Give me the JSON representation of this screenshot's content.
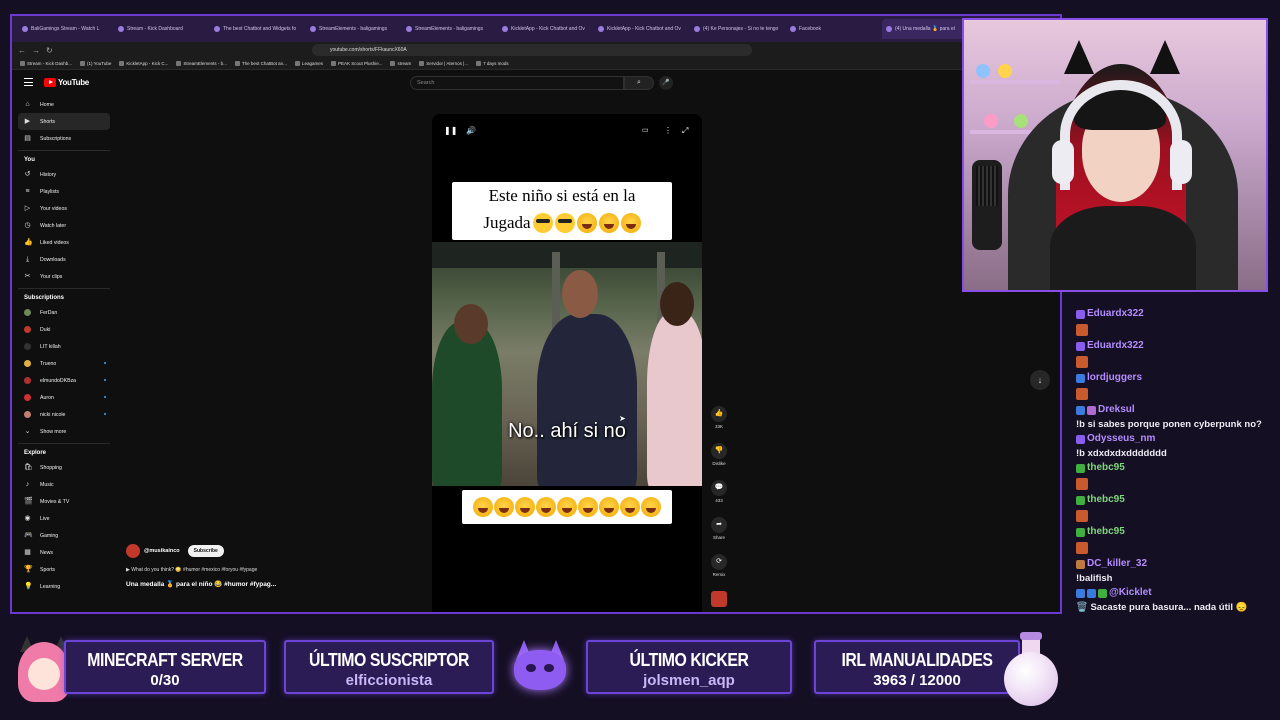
{
  "browser": {
    "tabs": [
      {
        "label": "BaliGamings Stream - Watch L",
        "active": false
      },
      {
        "label": "Stream - Kick Dashboard",
        "active": false
      },
      {
        "label": "The best Chatbot and Widgets fo",
        "active": false
      },
      {
        "label": "StreamElements - baligamings",
        "active": false
      },
      {
        "label": "StreamElements - baligamings",
        "active": false
      },
      {
        "label": "KickletApp - Kick Chatbot and Ov",
        "active": false
      },
      {
        "label": "KickletApp - Kick Chatbot and Ov",
        "active": false
      },
      {
        "label": "(4) Ke Personajes - Si no te tengo",
        "active": false
      },
      {
        "label": "Facebook",
        "active": false
      },
      {
        "label": "(4) Una medalla 🏅 para el",
        "active": true
      }
    ],
    "url": "youtube.com/shorts/FFkauncX60A",
    "bookmarks": [
      "Stream - Kick Dashb...",
      "(1) YouTube",
      "KickletApp - Kick C...",
      "StreamElements - b...",
      "The best ChatBot an...",
      "Leagames",
      "PEAK Scout Plushie...",
      "stream",
      "Servidor | Aternos |...",
      "7 days mods"
    ]
  },
  "youtube": {
    "logo": "YouTube",
    "search_placeholder": "Search",
    "nav": [
      {
        "label": "Home",
        "icon": "home-icon",
        "glyph": "⌂",
        "active": false
      },
      {
        "label": "Shorts",
        "icon": "shorts-icon",
        "glyph": "▶",
        "active": true
      },
      {
        "label": "Subscriptions",
        "icon": "subscriptions-icon",
        "glyph": "▤",
        "active": false
      }
    ],
    "you_heading": "You",
    "you_items": [
      {
        "label": "History",
        "icon": "history-icon",
        "glyph": "↺"
      },
      {
        "label": "Playlists",
        "icon": "playlists-icon",
        "glyph": "≡"
      },
      {
        "label": "Your videos",
        "icon": "your-videos-icon",
        "glyph": "▷"
      },
      {
        "label": "Watch later",
        "icon": "watch-later-icon",
        "glyph": "◷"
      },
      {
        "label": "Liked videos",
        "icon": "liked-videos-icon",
        "glyph": "👍"
      },
      {
        "label": "Downloads",
        "icon": "downloads-icon",
        "glyph": "⤓"
      },
      {
        "label": "Your clips",
        "icon": "clips-icon",
        "glyph": "✂"
      }
    ],
    "subscriptions_heading": "Subscriptions",
    "subscriptions": [
      {
        "label": "FerDan",
        "color": "#6a8a5a",
        "dot": false
      },
      {
        "label": "Duki",
        "color": "#c0392b",
        "dot": false
      },
      {
        "label": "LIT killah",
        "color": "#333333",
        "dot": false
      },
      {
        "label": "Trueno",
        "color": "#e0b040",
        "dot": true
      },
      {
        "label": "elmundoDKBza",
        "color": "#b03030",
        "dot": true
      },
      {
        "label": "Auron",
        "color": "#d03030",
        "dot": true
      },
      {
        "label": "nicki nicole",
        "color": "#c08070",
        "dot": true
      }
    ],
    "show_more": "Show more",
    "explore_heading": "Explore",
    "explore": [
      {
        "label": "Shopping",
        "icon": "shopping-icon",
        "glyph": "🛍"
      },
      {
        "label": "Music",
        "icon": "music-icon",
        "glyph": "♪"
      },
      {
        "label": "Movies & TV",
        "icon": "movies-icon",
        "glyph": "🎬"
      },
      {
        "label": "Live",
        "icon": "live-icon",
        "glyph": "◉"
      },
      {
        "label": "Gaming",
        "icon": "gaming-icon",
        "glyph": "🎮"
      },
      {
        "label": "News",
        "icon": "news-icon",
        "glyph": "▦"
      },
      {
        "label": "Sports",
        "icon": "sports-icon",
        "glyph": "🏆"
      },
      {
        "label": "Learning",
        "icon": "learning-icon",
        "glyph": "💡"
      }
    ],
    "short": {
      "caption_line1": "Este niño si está en la",
      "caption_line2": "Jugada",
      "scene_caption": "No.. ahí si no",
      "likes": "33K",
      "dislike": "Dislike",
      "comments": "433",
      "share": "Share",
      "remix": "Remix"
    },
    "channel": "@musikainco",
    "subscribe": "Subscribe",
    "desc_line": "▶ What do you think? 😳 #humor #mexico #foryou #fypage",
    "title": "Una medalla 🏅 para el niño 😂 #humor #fypag..."
  },
  "chat": [
    {
      "user": "Eduardx322",
      "color": "#b48cff",
      "badges": [
        "#8a5cf0"
      ],
      "text": "",
      "emote": true
    },
    {
      "user": "Eduardx322",
      "color": "#b48cff",
      "badges": [
        "#8a5cf0"
      ],
      "text": "",
      "emote": true
    },
    {
      "user": "lordjuggers",
      "color": "#b48cff",
      "badges": [
        "#3b7be0"
      ],
      "text": "",
      "emote": true
    },
    {
      "user": "Dreksul",
      "color": "#b48cff",
      "badges": [
        "#3b7be0",
        "#b06ad0"
      ],
      "text": "!b si sabes porque ponen cyberpunk no?",
      "emote": false
    },
    {
      "user": "Odysseus_nm",
      "color": "#b48cff",
      "badges": [
        "#8a5cf0"
      ],
      "text": "!b xdxdxdxddddddd",
      "emote": false
    },
    {
      "user": "thebc95",
      "color": "#7fd67a",
      "badges": [
        "#3fb03f"
      ],
      "text": "",
      "emote": true
    },
    {
      "user": "thebc95",
      "color": "#7fd67a",
      "badges": [
        "#3fb03f"
      ],
      "text": "",
      "emote": true
    },
    {
      "user": "thebc95",
      "color": "#7fd67a",
      "badges": [
        "#3fb03f"
      ],
      "text": "",
      "emote": true
    },
    {
      "user": "DC_killer_32",
      "color": "#b48cff",
      "badges": [
        "#c07a40"
      ],
      "text": "!balifish",
      "emote": false
    },
    {
      "user": "@Kicklet",
      "color": "#b48cff",
      "badges": [
        "#3b7be0",
        "#3b7be0",
        "#3fb03f"
      ],
      "text": "🗑️ Sacaste pura basura... nada útil 😞",
      "emote": false
    }
  ],
  "panels": {
    "minecraft": {
      "title": "MINECRAFT SERVER",
      "value": "0/30"
    },
    "subscriber": {
      "title": "ÚLTIMO SUSCRIPTOR",
      "value": "elficcionista"
    },
    "kicker": {
      "title": "ÚLTIMO KICKER",
      "value": "jolsmen_aqp"
    },
    "irl": {
      "title": "IRL MANUALIDADES",
      "value": "3963 / 12000"
    }
  },
  "colors": {
    "accent": "#6a3ad0",
    "youtube_red": "#ff0000",
    "panel_bg": "#2c1c55"
  }
}
